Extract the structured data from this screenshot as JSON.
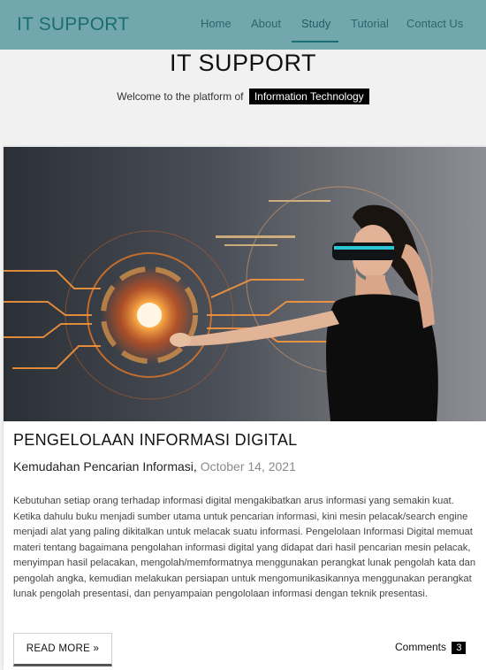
{
  "navbar": {
    "brand": "IT SUPPORT",
    "items": [
      {
        "label": "Home"
      },
      {
        "label": "About"
      },
      {
        "label": "Study"
      },
      {
        "label": "Tutorial"
      },
      {
        "label": "Contact Us"
      }
    ],
    "active_item": "Study"
  },
  "hero": {
    "title": "IT SUPPORT",
    "welcome_text": "Welcome to the platform of",
    "welcome_tag": "Information Technology"
  },
  "post": {
    "title": "PENGELOLAAN INFORMASI DIGITAL",
    "subtitle": "Kemudahan Pencarian Informasi,",
    "date": "October 14, 2021",
    "excerpt": "Kebutuhan setiap orang terhadap informasi digital mengakibatkan arus informasi yang semakin kuat. Ketika dahulu buku menjadi sumber utama untuk pencarian informasi, kini mesin pelacak/search engine menjadi alat yang paling dikitalkan untuk melacak suatu informasi. Pengelolaan Informasi Digital memuat materi tentang bagaimana pengolahan informasi digital yang didapat dari hasil pencarian mesin pelacak, menyimpan hasil pelacakan, mengolah/memformatnya menggunakan perangkat lunak pengolah kata dan pengolah angka, kemudian melakukan persiapan untuk mengomunikasikannya menggunakan perangkat lunak pengolah presentasi, dan penyampaian pengololaan informasi dengan teknik presentasi.",
    "read_more_label": "READ MORE »",
    "comments_label": "Comments",
    "comments_count": "3"
  },
  "colors": {
    "navbar_bg": "#72a8ad",
    "brand": "#1c6c74",
    "page_bg": "#f1f1f1",
    "tag_bg": "#000000"
  }
}
